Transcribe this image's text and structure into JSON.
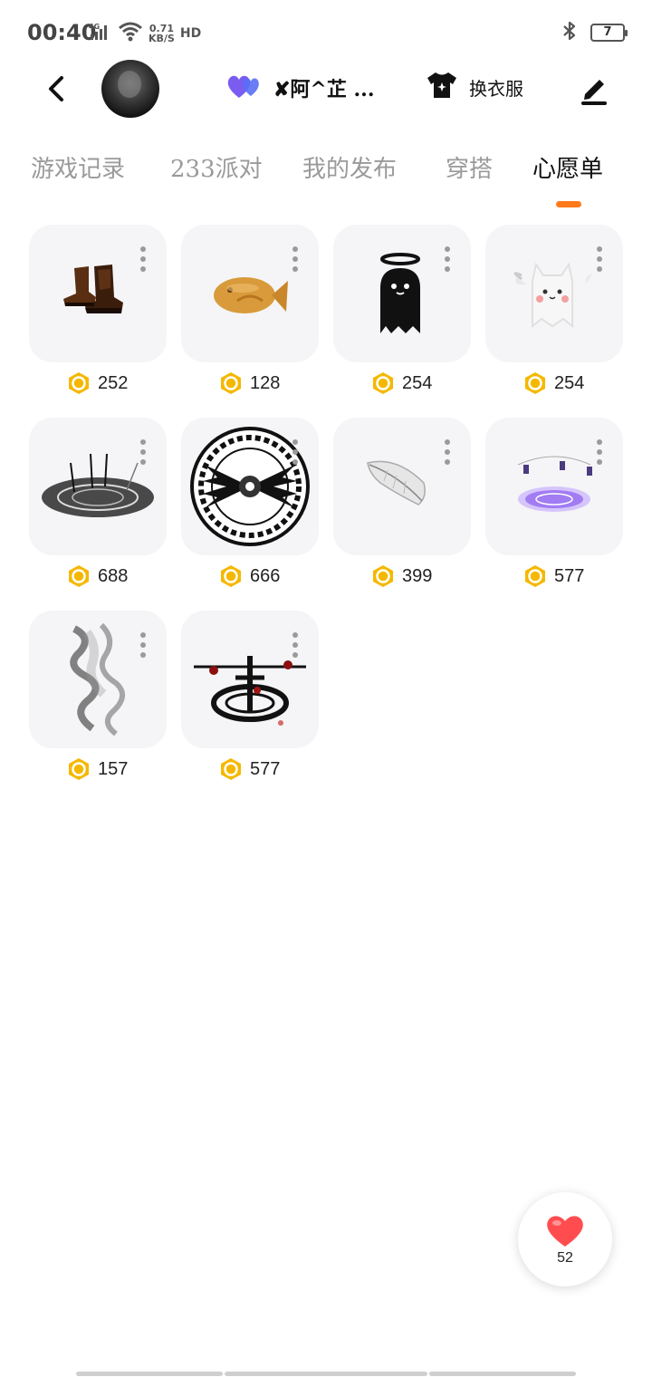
{
  "status_bar": {
    "time": "00:40",
    "network": "4G",
    "speed_value": "0.71",
    "speed_unit": "KB/S",
    "hd": "HD",
    "battery": "7"
  },
  "header": {
    "partner_name": "✘阿^芷 ...",
    "dressup_label": "换衣服"
  },
  "tabs": [
    {
      "label": "游戏记录",
      "active": false
    },
    {
      "label": "233派对",
      "active": false
    },
    {
      "label": "我的发布",
      "active": false
    },
    {
      "label": "穿搭",
      "active": false
    },
    {
      "label": "心愿单",
      "active": true
    }
  ],
  "wishlist": [
    {
      "name": "boots",
      "price": "252"
    },
    {
      "name": "fish-snack",
      "price": "128"
    },
    {
      "name": "ghost-halo",
      "price": "254"
    },
    {
      "name": "cat-ghost-wings",
      "price": "254"
    },
    {
      "name": "summoning-circle",
      "price": "688"
    },
    {
      "name": "raven-sigil",
      "price": "666"
    },
    {
      "name": "white-feather",
      "price": "399"
    },
    {
      "name": "purple-portal",
      "price": "577"
    },
    {
      "name": "smoke-effect",
      "price": "157"
    },
    {
      "name": "blood-sigil",
      "price": "577"
    }
  ],
  "like_fab": {
    "count": "52"
  },
  "colors": {
    "accent": "#ff7a1a",
    "coin": "#f5b800",
    "heart": "#ff4d4f",
    "partner_heart": "#7b5cf0"
  }
}
